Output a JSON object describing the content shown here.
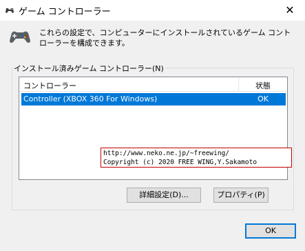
{
  "window": {
    "title": "ゲーム コントローラー",
    "icon": "gamepad-icon",
    "close_glyph": "✕"
  },
  "description": "これらの設定で、コンピューターにインストールされているゲーム コントローラーを構成できます。",
  "group": {
    "label": "インストール済みゲーム コントローラー(N)"
  },
  "list": {
    "columns": [
      "コントローラー",
      "状態"
    ],
    "rows": [
      {
        "name": "Controller (XBOX 360 For Windows)",
        "status": "OK",
        "selected": true
      }
    ]
  },
  "watermark": {
    "line1": "http://www.neko.ne.jp/~freewing/",
    "line2": "Copyright (c) 2020 FREE WING,Y.Sakamoto"
  },
  "buttons": {
    "advanced": "詳細設定(D)...",
    "properties": "プロパティ(P)",
    "ok": "OK"
  },
  "colors": {
    "selection": "#0078d7",
    "watermark_border": "#c00000"
  }
}
